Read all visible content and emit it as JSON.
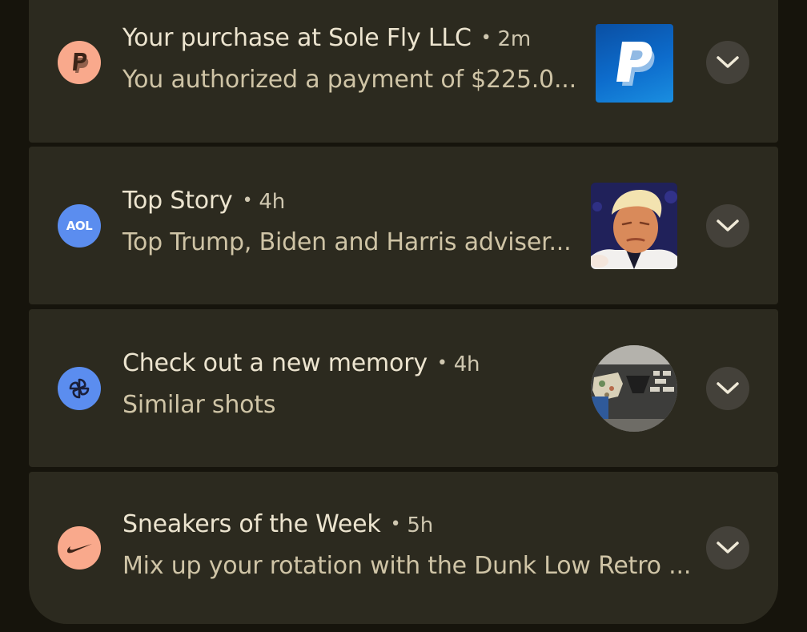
{
  "notifications": [
    {
      "app_icon": "paypal-icon",
      "icon_color": "#f9a98c",
      "title": "Your purchase at Sole Fly LLC",
      "time": "2m",
      "body": "You authorized a payment of $225.0...",
      "thumbnail": "paypal-logo-image"
    },
    {
      "app_icon": "aol-icon",
      "icon_color": "#5b8def",
      "icon_text": "AOL",
      "title": "Top Story",
      "time": "4h",
      "body": "Top Trump, Biden and Harris adviser...",
      "thumbnail": "news-portrait-image"
    },
    {
      "app_icon": "google-photos-pinwheel-icon",
      "icon_color": "#5b8def",
      "title": "Check out a new memory",
      "time": "4h",
      "body": "Similar shots",
      "thumbnail": "memory-photo-image"
    },
    {
      "app_icon": "nike-swoosh-icon",
      "icon_color": "#f9a98c",
      "title": "Sneakers of the Week",
      "time": "5h",
      "body": "Mix up your rotation with the Dunk Low Retro ...",
      "thumbnail": ""
    }
  ],
  "separator": "•",
  "colors": {
    "background": "#16140c",
    "card": "#2c2a1f",
    "title_text": "#ece4cf",
    "body_text": "#cfc4a6",
    "expand_button": "#44413a"
  }
}
